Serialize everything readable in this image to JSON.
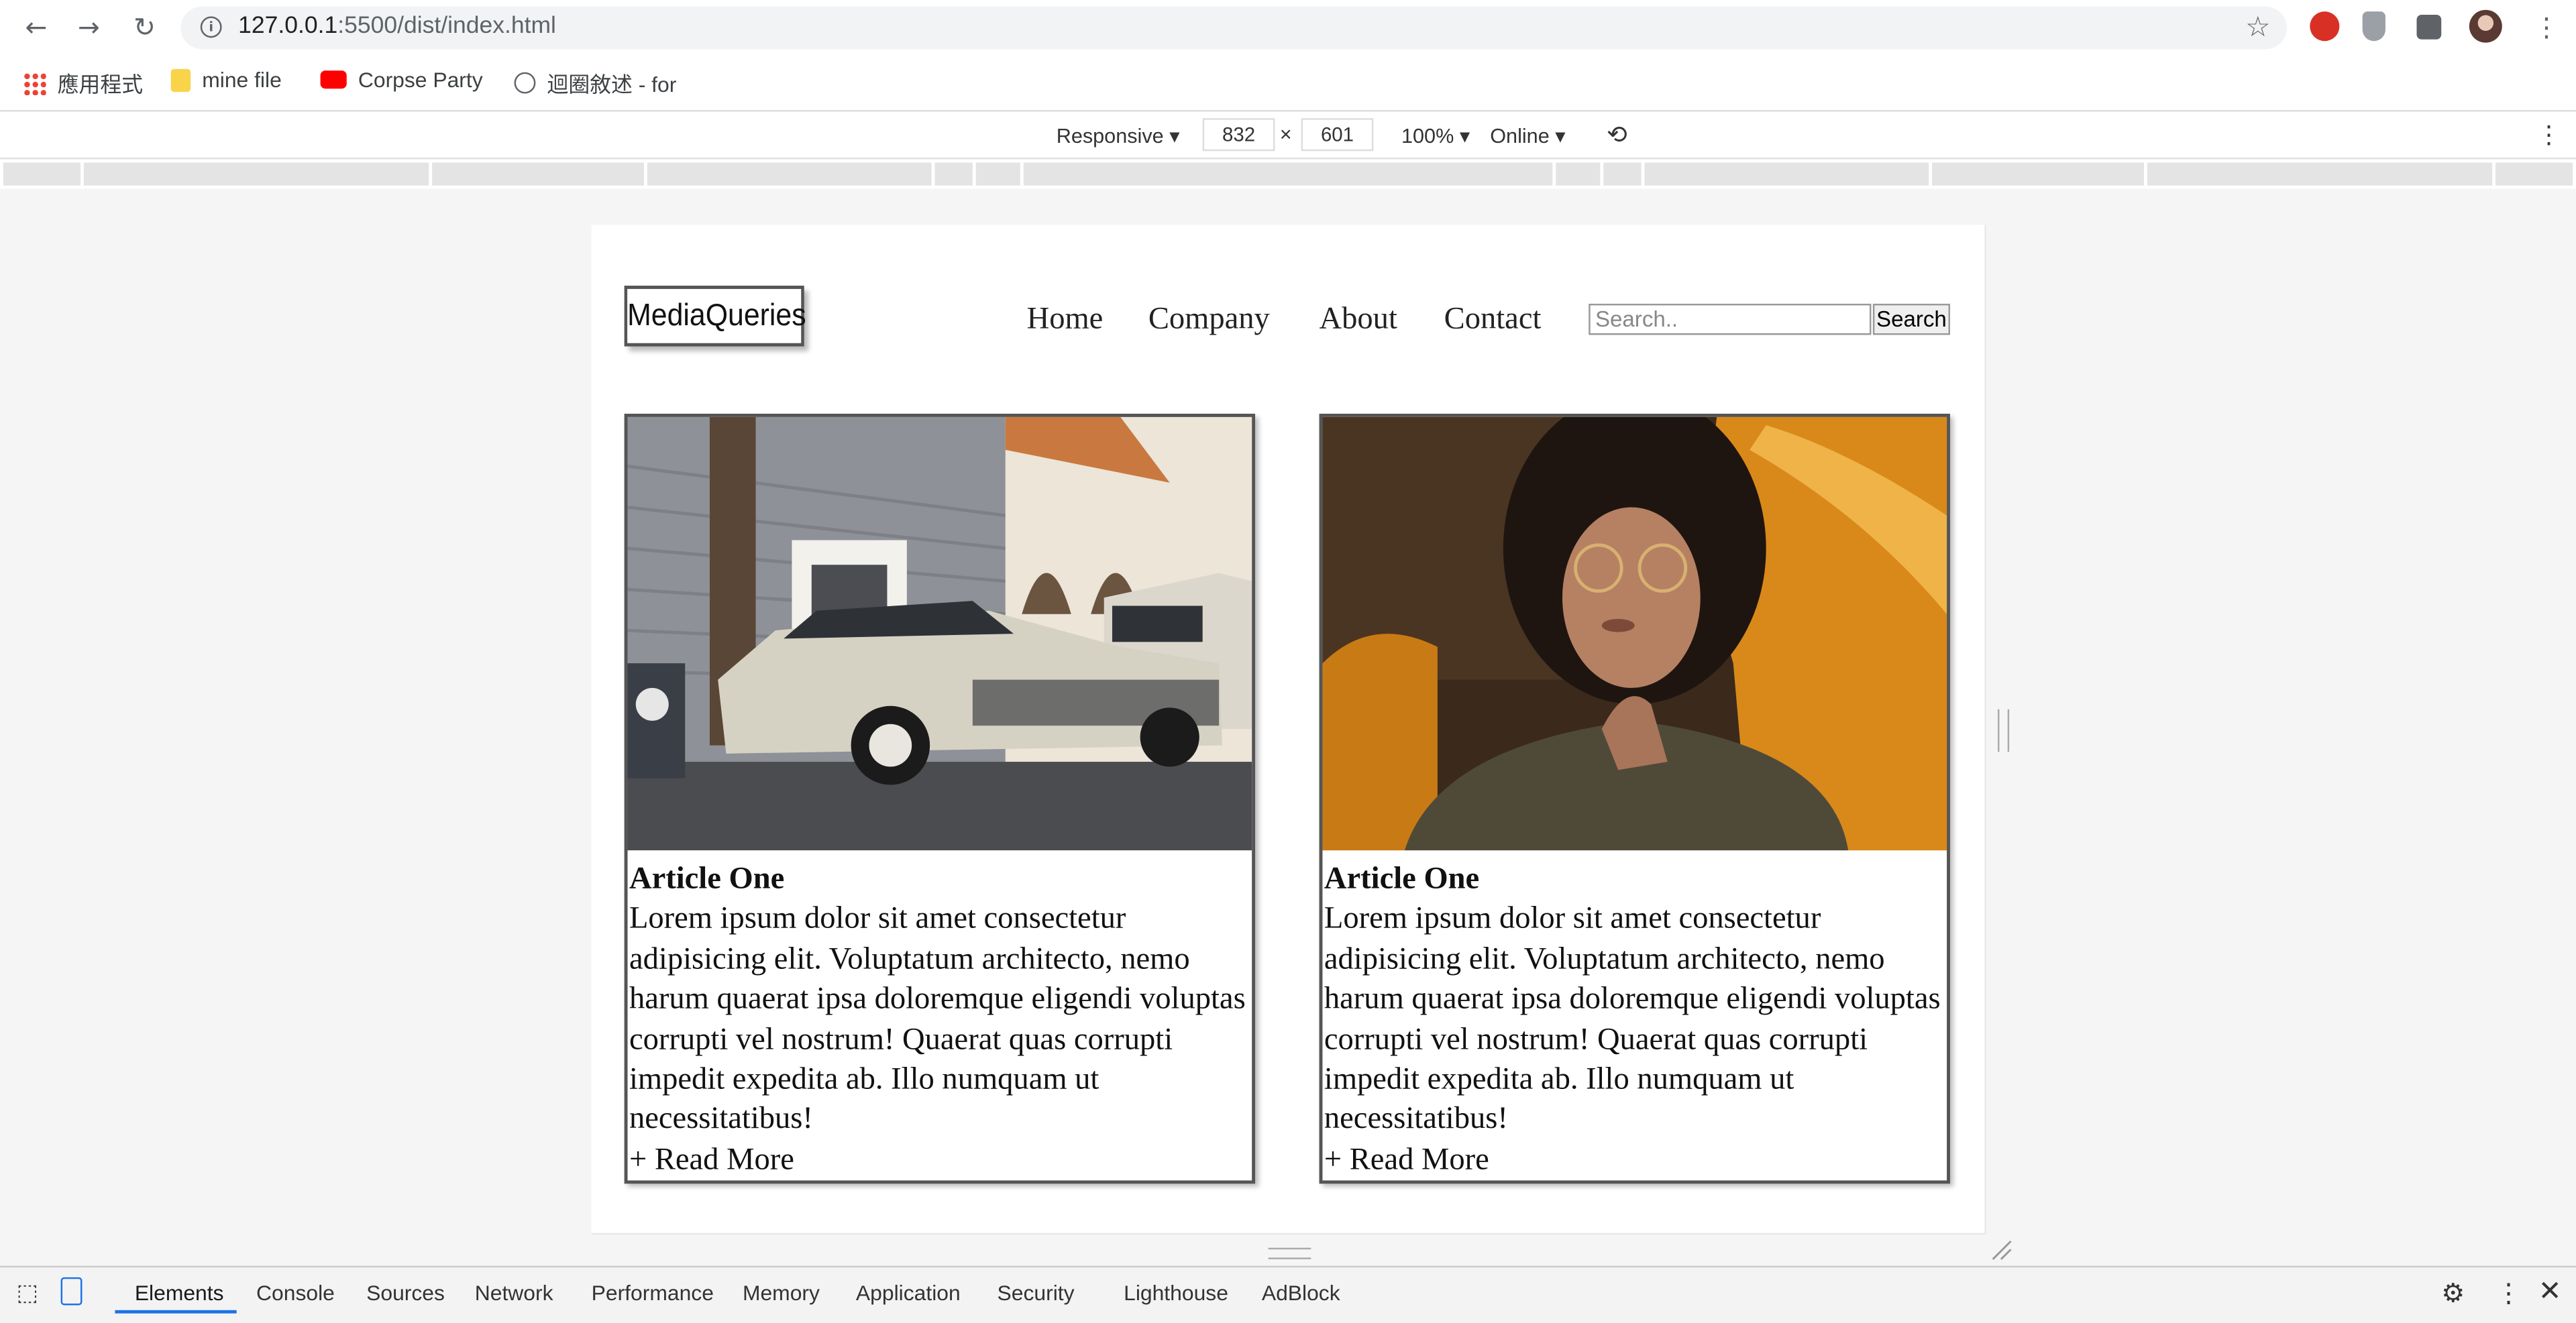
{
  "browser": {
    "url_host": "127.0.0.1",
    "url_path": ":5500/dist/index.html",
    "bookmarks": [
      {
        "label": "應用程式"
      },
      {
        "label": "mine file"
      },
      {
        "label": "Corpse Party"
      },
      {
        "label": "迴圈敘述 - for"
      }
    ]
  },
  "device_toolbar": {
    "mode": "Responsive",
    "width": "832",
    "height": "601",
    "times": "×",
    "zoom": "100%",
    "network": "Online"
  },
  "site": {
    "logo": "MediaQueries",
    "nav": [
      "Home",
      "Company",
      "About",
      "Contact"
    ],
    "search_placeholder": "Search..",
    "search_button": "Search",
    "articles": [
      {
        "title": "Article One",
        "body": "Lorem ipsum dolor sit amet consectetur adipisicing elit. Voluptatum architecto, nemo harum quaerat ipsa doloremque eligendi voluptas corrupti vel nostrum! Quaerat quas corrupti impedit expedita ab. Illo numquam ut necessitatibus!",
        "link": "+ Read More",
        "image": "classic-car-photo"
      },
      {
        "title": "Article One",
        "body": "Lorem ipsum dolor sit amet consectetur adipisicing elit. Voluptatum architecto, nemo harum quaerat ipsa doloremque eligendi voluptas corrupti vel nostrum! Quaerat quas corrupti impedit expedita ab. Illo numquam ut necessitatibus!",
        "link": "+ Read More",
        "image": "woman-with-orange-car-photo"
      }
    ]
  },
  "devtools": {
    "tabs": [
      "Elements",
      "Console",
      "Sources",
      "Network",
      "Performance",
      "Memory",
      "Application",
      "Security",
      "Lighthouse",
      "AdBlock"
    ],
    "active_tab": "Elements"
  }
}
